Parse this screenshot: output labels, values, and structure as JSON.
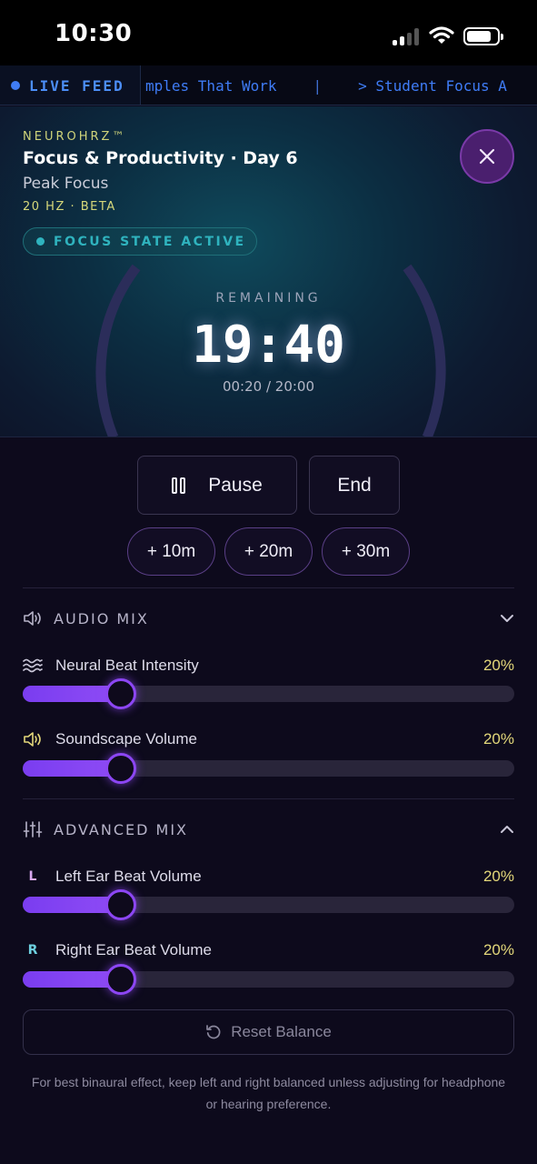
{
  "status_bar": {
    "time": "10:30"
  },
  "ticker": {
    "live_label": "LIVE FEED",
    "items": [
      "mples That Work",
      "|",
      "> Student Focus A"
    ]
  },
  "session": {
    "brand": "NEUROHRZ™",
    "title": "Focus & Productivity · Day 6",
    "subtitle": "Peak Focus",
    "frequency": "20 HZ · BETA",
    "state": "FOCUS STATE ACTIVE",
    "remaining_label": "REMAINING",
    "timer": "19:40",
    "progress_text": "00:20 / 20:00",
    "progress_fraction": 0.0167
  },
  "controls": {
    "pause_label": "Pause",
    "end_label": "End",
    "add_time": [
      "+ 10m",
      "+ 20m",
      "+ 30m"
    ]
  },
  "audio_mix": {
    "title": "AUDIO MIX",
    "sliders": [
      {
        "label": "Neural Beat Intensity",
        "value_text": "20%",
        "value": 20
      },
      {
        "label": "Soundscape Volume",
        "value_text": "20%",
        "value": 20
      }
    ]
  },
  "advanced_mix": {
    "title": "ADVANCED MIX",
    "sliders": [
      {
        "prefix": "L",
        "label": "Left Ear Beat Volume",
        "value_text": "20%",
        "value": 20
      },
      {
        "prefix": "R",
        "label": "Right Ear Beat Volume",
        "value_text": "20%",
        "value": 20
      }
    ],
    "reset_label": "Reset Balance",
    "footnote": "For best binaural effect, keep left and right balanced unless adjusting for headphone or hearing preference."
  },
  "colors": {
    "accent_purple": "#8c46f3",
    "value_yellow": "#e3d77a",
    "state_teal": "#2fb3be",
    "live_blue": "#3f7cf6",
    "left_ear": "#d9a8f0",
    "right_ear": "#6ed0e0"
  }
}
